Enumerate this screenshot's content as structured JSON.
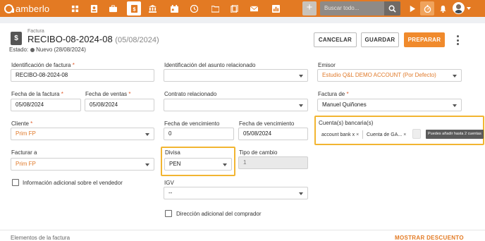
{
  "app": {
    "name": "amberlo"
  },
  "topbar": {
    "nav_icons": [
      "dashboard-icon",
      "contacts-icon",
      "briefcase-icon",
      "billing-icon",
      "bank-icon",
      "calendar-icon",
      "history-icon",
      "folder-icon",
      "documents-icon",
      "mail-icon",
      "reports-icon"
    ],
    "active_icon": "billing-icon",
    "plus_label": "+",
    "search_placeholder": "Buscar todo...",
    "accent": "#e37a23"
  },
  "header": {
    "doc_type": "Factura",
    "doc_icon": "$",
    "title": "RECIBO-08-2024-08",
    "title_date": "(05/08/2024)",
    "status_label": "Estado:",
    "status_value": "Nuevo (28/08/2024)",
    "buttons": {
      "cancel": "CANCELAR",
      "save": "GUARDAR",
      "prepare": "PREPARAR"
    }
  },
  "form": {
    "invoice_id": {
      "label": "Identificación de factura",
      "required": "*",
      "value": "RECIBO-08-2024-08"
    },
    "related_matter_id": {
      "label": "Identificación del asunto relacionado",
      "value": ""
    },
    "issuer": {
      "label": "Emisor",
      "value": "Estudio Q&L DEMO ACCOUNT (Por Defecto)"
    },
    "invoice_date": {
      "label": "Fecha de la factura",
      "required": "*",
      "value": "05/08/2024"
    },
    "sales_date": {
      "label": "Fecha de ventas",
      "required": "*",
      "value": "05/08/2024"
    },
    "related_contract": {
      "label": "Contrato relacionado",
      "value": ""
    },
    "invoice_of": {
      "label": "Factura de",
      "required": "*",
      "value": "Manuel Quiñones"
    },
    "client": {
      "label": "Cliente",
      "required": "*",
      "value": "Prim FP"
    },
    "due_days": {
      "label": "Fecha de vencimiento",
      "value": "0"
    },
    "due_date": {
      "label": "Fecha de vencimiento",
      "value": "05/08/2024"
    },
    "bank_accounts": {
      "label": "Cuenta(s) bancaria(s)",
      "chips": [
        "account bank x",
        "Cuenta de GA..."
      ],
      "chip_close": "×",
      "tooltip": "Puedes añadir hasta 2 cuentas"
    },
    "bill_to": {
      "label": "Facturar a",
      "value": "Prim FP"
    },
    "currency": {
      "label": "Divisa",
      "value": "PEN"
    },
    "exchange_rate": {
      "label": "Tipo de cambio",
      "value": "1"
    },
    "seller_info": {
      "label": "Información adicional sobre el vendedor",
      "checked": false
    },
    "igv": {
      "label": "IGV",
      "value": "--"
    },
    "buyer_address": {
      "label": "Dirección adicional del comprador",
      "checked": false
    }
  },
  "footer": {
    "section_title": "Elementos de la factura",
    "discount_link": "MOSTRAR DESCUENTO"
  }
}
